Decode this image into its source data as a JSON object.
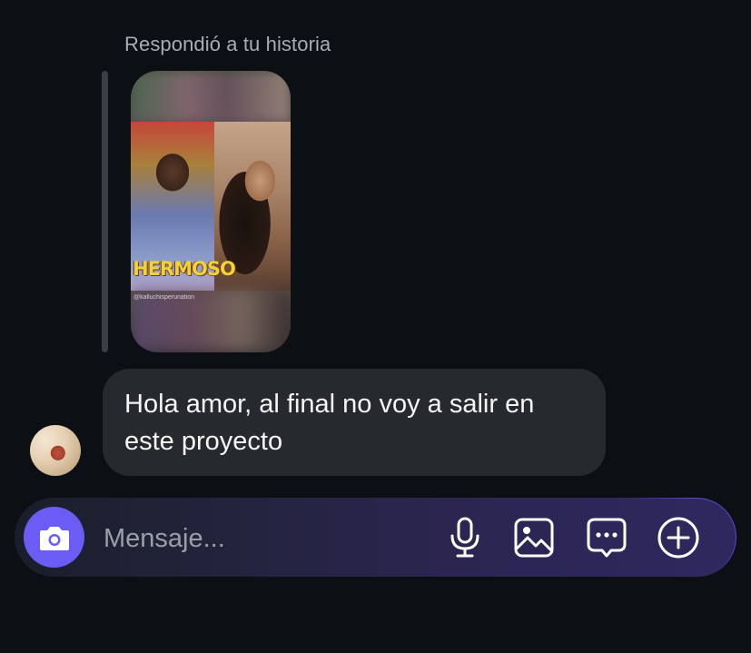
{
  "thread": {
    "reply_caption": "Respondió a tu historia",
    "story": {
      "overlay_title": "HERMOSO",
      "overlay_handle": "@kalluchisperunation"
    },
    "message": {
      "text": "Hola amor, al final no voy a salir en este proyecto"
    }
  },
  "composer": {
    "placeholder": "Mensaje...",
    "value": "",
    "icons": {
      "camera": "camera-icon",
      "mic": "microphone-icon",
      "gallery": "image-icon",
      "sticker": "chat-sticker-icon",
      "plus": "plus-circle-icon"
    },
    "accent_color": "#6a5cf4"
  },
  "theme": {
    "background": "#0c1014",
    "bubble": "#262a2f",
    "caption": "#a8aeb4"
  }
}
